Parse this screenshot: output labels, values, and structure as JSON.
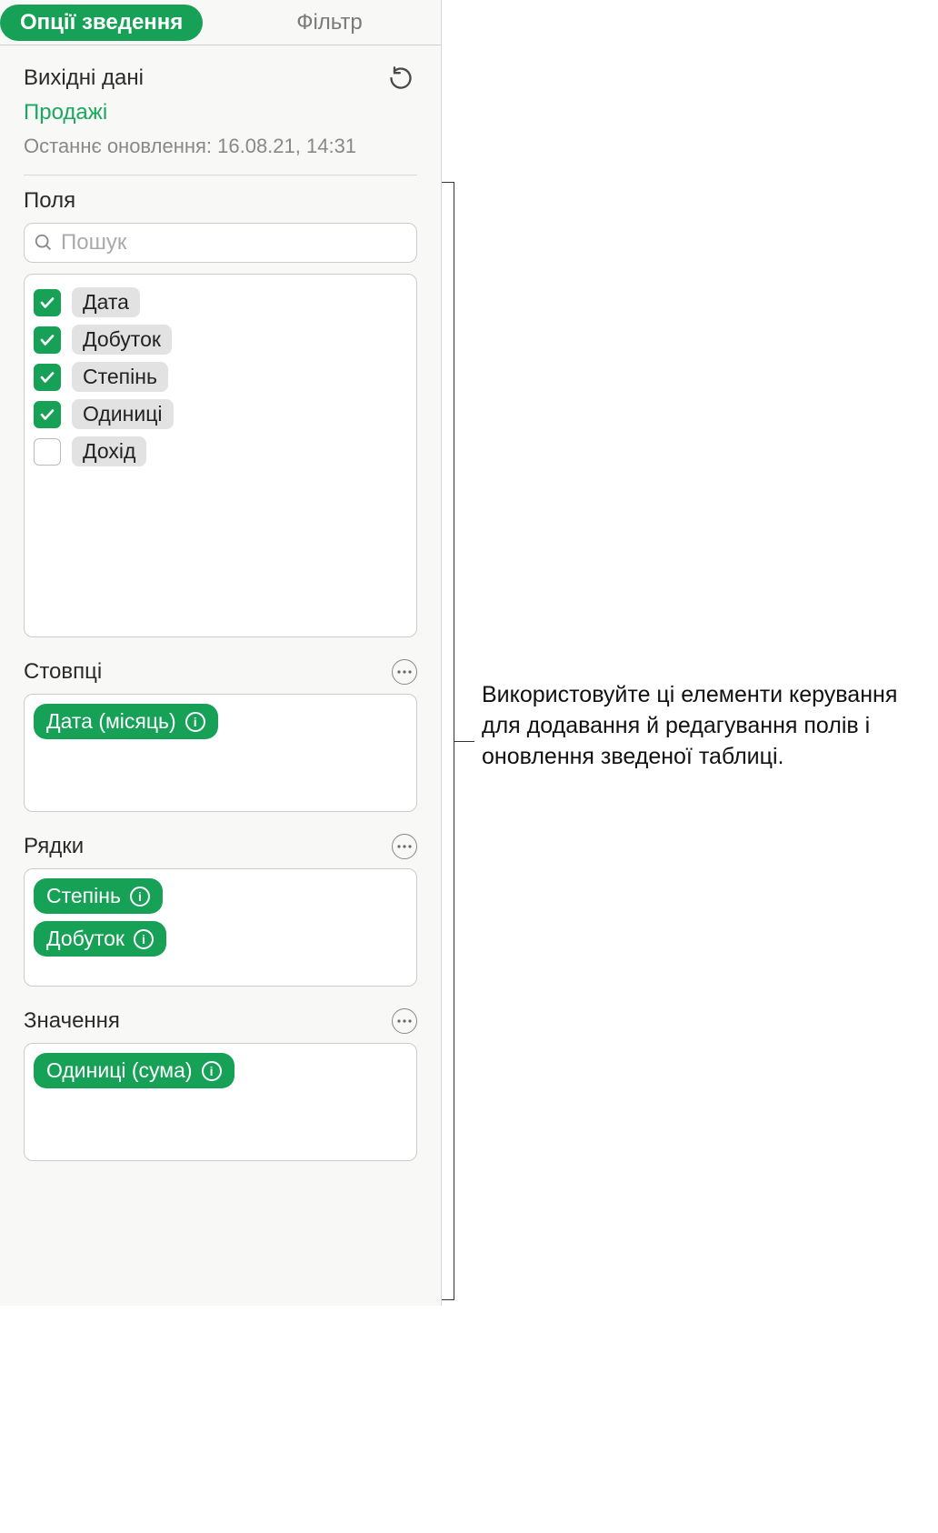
{
  "tabs": {
    "pivot_options": "Опції зведення",
    "filter": "Фільтр"
  },
  "source": {
    "title": "Вихідні дані",
    "name": "Продажі",
    "last_updated": "Останнє оновлення: 16.08.21, 14:31"
  },
  "fields_section": {
    "label": "Поля",
    "search_placeholder": "Пошук",
    "items": [
      {
        "label": "Дата",
        "checked": true
      },
      {
        "label": "Добуток",
        "checked": true
      },
      {
        "label": "Степінь",
        "checked": true
      },
      {
        "label": "Одиниці",
        "checked": true
      },
      {
        "label": "Дохід",
        "checked": false
      }
    ]
  },
  "columns": {
    "label": "Стовпці",
    "tokens": [
      "Дата (місяць)"
    ]
  },
  "rows": {
    "label": "Рядки",
    "tokens": [
      "Степінь",
      "Добуток"
    ]
  },
  "values": {
    "label": "Значення",
    "tokens": [
      "Одиниці (сума)"
    ]
  },
  "callout": "Використовуйте ці елементи керування для додавання й редагування полів і оновлення зведеної таблиці."
}
